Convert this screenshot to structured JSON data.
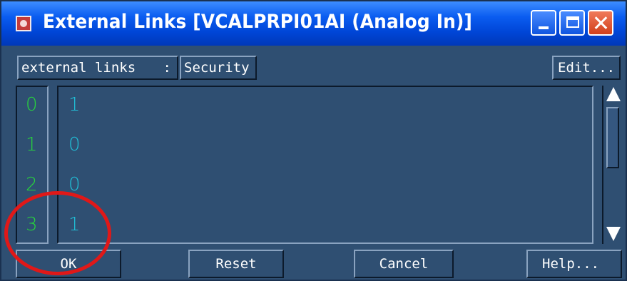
{
  "window": {
    "title": "External Links [VCALPRPI01AI (Analog In)]"
  },
  "toolbar": {
    "links_select_value": "external links",
    "links_select_arrow": ":",
    "security_label": "Security",
    "edit_label": "Edit..."
  },
  "list": {
    "indices": [
      "0",
      "1",
      "2",
      "3"
    ],
    "values": [
      "1",
      "0",
      "0",
      "1"
    ]
  },
  "footer": {
    "ok_label": "OK",
    "reset_label": "Reset",
    "cancel_label": "Cancel",
    "help_label": "Help..."
  },
  "colors": {
    "index_text": "#27d43c",
    "value_text": "#20c0d8",
    "annotation": "#e01818"
  }
}
